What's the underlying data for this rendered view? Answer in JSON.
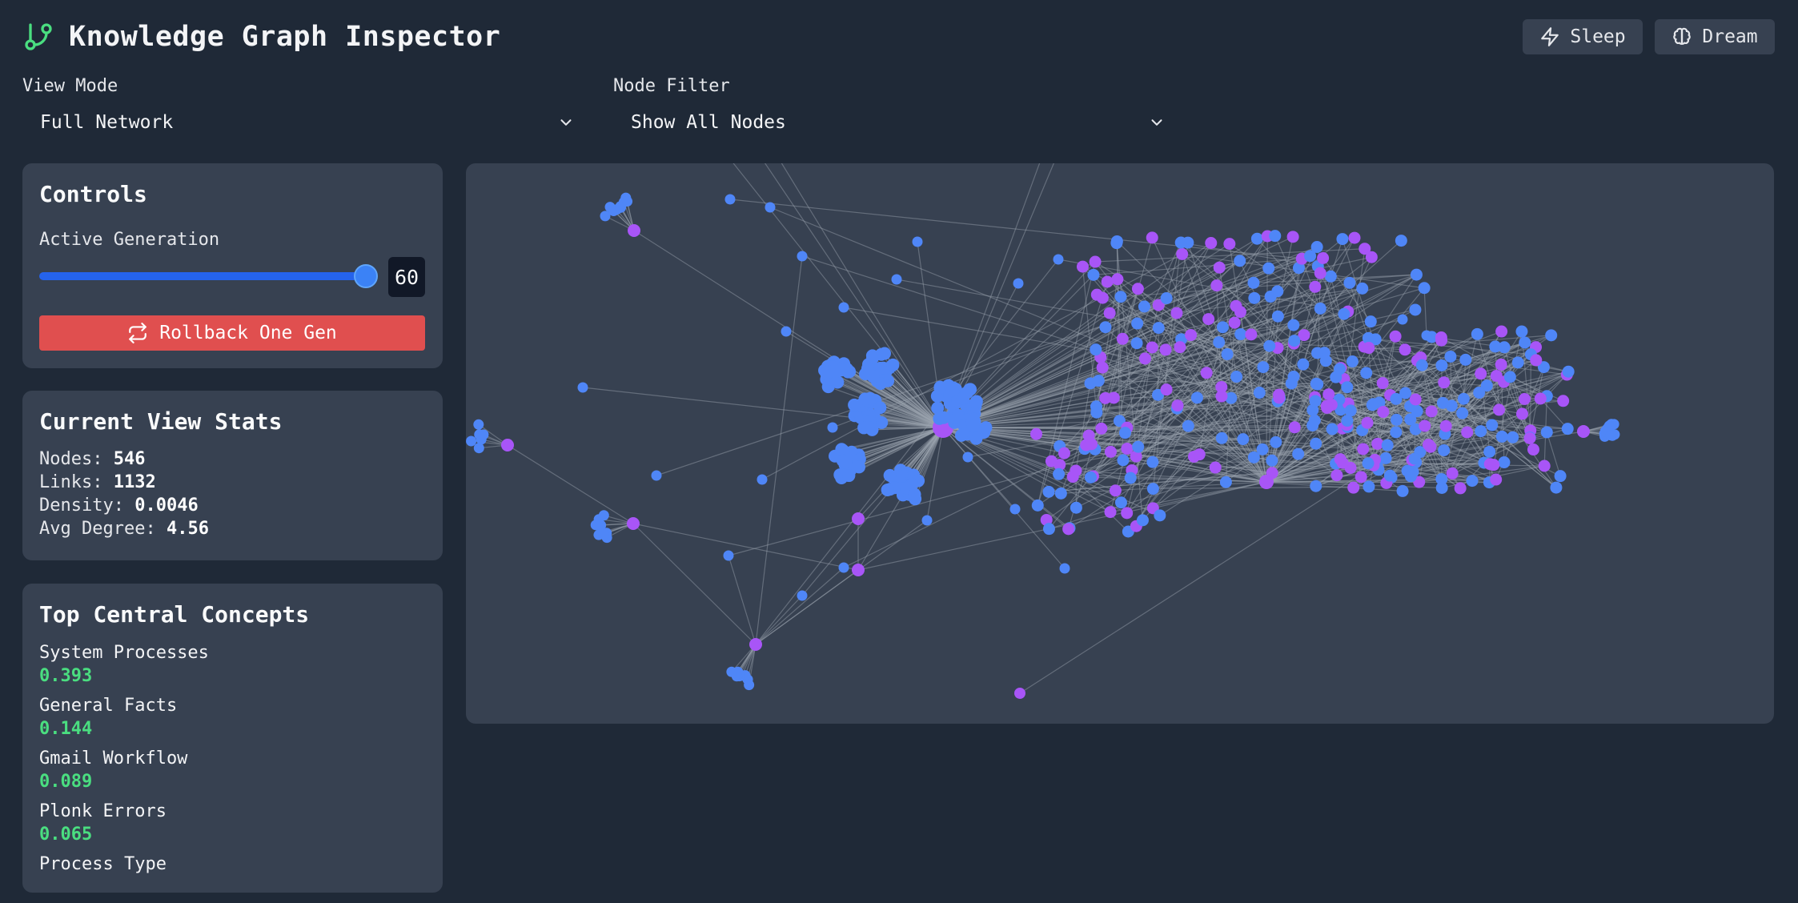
{
  "header": {
    "title": "Knowledge Graph Inspector",
    "sleep_label": "Sleep",
    "dream_label": "Dream",
    "logo_icon": "git-branch-icon",
    "accent": "#4ade80"
  },
  "filters": {
    "view_mode_label": "View Mode",
    "view_mode_value": "Full Network",
    "node_filter_label": "Node Filter",
    "node_filter_value": "Show All Nodes"
  },
  "controls": {
    "title": "Controls",
    "generation_label": "Active Generation",
    "generation_value": "60",
    "generation_fraction": 1.0,
    "rollback_label": "Rollback One Gen",
    "rollback_color": "#e04f4f"
  },
  "stats": {
    "title": "Current View Stats",
    "nodes_label": "Nodes:",
    "nodes_value": "546",
    "links_label": "Links:",
    "links_value": "1132",
    "density_label": "Density:",
    "density_value": "0.0046",
    "avg_degree_label": "Avg Degree:",
    "avg_degree_value": "4.56"
  },
  "central": {
    "title": "Top Central Concepts",
    "items": [
      {
        "name": "System Processes",
        "score": "0.393"
      },
      {
        "name": "General Facts",
        "score": "0.144"
      },
      {
        "name": "Gmail Workflow",
        "score": "0.089"
      },
      {
        "name": "Plonk Errors",
        "score": "0.065"
      },
      {
        "name": "Process Type",
        "score": ""
      }
    ]
  },
  "graph": {
    "colors": {
      "concept": "#4f86f7",
      "hub": "#a855f7",
      "edge": "#9ca3af",
      "panel": "#374151"
    }
  }
}
